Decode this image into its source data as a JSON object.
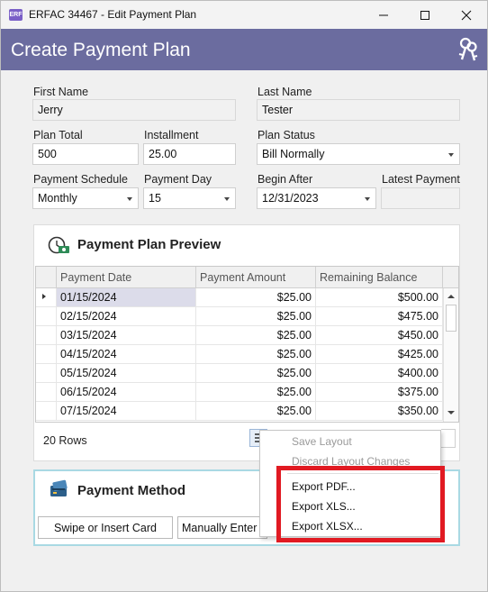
{
  "window": {
    "app_icon_text": "ERF",
    "title": "ERFAC 34467 - Edit Payment Plan"
  },
  "header": {
    "title": "Create Payment Plan"
  },
  "form": {
    "first_name": {
      "label": "First Name",
      "value": "Jerry"
    },
    "last_name": {
      "label": "Last Name",
      "value": "Tester"
    },
    "plan_total": {
      "label": "Plan Total",
      "value": "500"
    },
    "installment": {
      "label": "Installment",
      "value": "25.00"
    },
    "plan_status": {
      "label": "Plan Status",
      "value": "Bill Normally"
    },
    "payment_schedule": {
      "label": "Payment Schedule",
      "value": "Monthly"
    },
    "payment_day": {
      "label": "Payment Day",
      "value": "15"
    },
    "begin_after": {
      "label": "Begin After",
      "value": "12/31/2023"
    },
    "latest_payment": {
      "label": "Latest Payment",
      "value": ""
    }
  },
  "preview": {
    "title": "Payment Plan Preview",
    "columns": [
      "Payment Date",
      "Payment Amount",
      "Remaining Balance"
    ],
    "rows": [
      [
        "01/15/2024",
        "$25.00",
        "$500.00"
      ],
      [
        "02/15/2024",
        "$25.00",
        "$475.00"
      ],
      [
        "03/15/2024",
        "$25.00",
        "$450.00"
      ],
      [
        "04/15/2024",
        "$25.00",
        "$425.00"
      ],
      [
        "05/15/2024",
        "$25.00",
        "$400.00"
      ],
      [
        "06/15/2024",
        "$25.00",
        "$375.00"
      ],
      [
        "07/15/2024",
        "$25.00",
        "$350.00"
      ]
    ],
    "row_count": "20 Rows"
  },
  "context_menu": {
    "items": [
      {
        "label": "Save Layout",
        "enabled": false
      },
      {
        "label": "Discard Layout Changes",
        "enabled": false
      },
      {
        "label": "Export PDF...",
        "enabled": true
      },
      {
        "label": "Export XLS...",
        "enabled": true
      },
      {
        "label": "Export XLSX...",
        "enabled": true
      }
    ]
  },
  "payment_method": {
    "title": "Payment Method",
    "swipe_label": "Swipe or Insert Card",
    "manual_label": "Manually Enter"
  },
  "colors": {
    "header_bg": "#6b6c9f",
    "selected_row": "#dcdcea",
    "highlight": "#e11a22",
    "payment_method_border": "#a9d9e3"
  }
}
